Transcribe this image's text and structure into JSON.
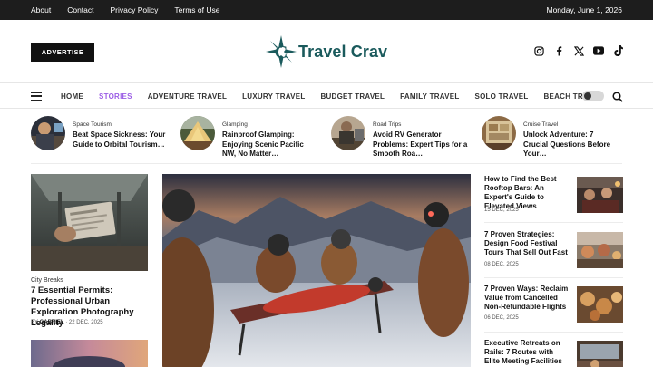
{
  "topbar": {
    "links": [
      "About",
      "Contact",
      "Privacy Policy",
      "Terms of Use"
    ],
    "date": "Monday, June 1, 2026"
  },
  "header": {
    "advertise_label": "ADVERTISE",
    "logo_text": "Travel Crav",
    "logo_color": "#1a5a5c",
    "social_icons": [
      "instagram-icon",
      "facebook-icon",
      "x-icon",
      "youtube-icon",
      "tiktok-icon"
    ]
  },
  "nav": {
    "items": [
      "HOME",
      "STORIES",
      "ADVENTURE TRAVEL",
      "LUXURY TRAVEL",
      "BUDGET TRAVEL",
      "FAMILY TRAVEL",
      "SOLO TRAVEL",
      "BEACH TRAVEL"
    ],
    "active_item": "STORIES",
    "active_color": "#9b5de5"
  },
  "trending": [
    {
      "category": "Space Tourism",
      "title": "Beat Space Sickness: Your Guide to Orbital Tourism…"
    },
    {
      "category": "Glamping",
      "title": "Rainproof Glamping: Enjoying Scenic Pacific NW, No Matter…"
    },
    {
      "category": "Road Trips",
      "title": "Avoid RV Generator Problems: Expert Tips for a Smooth Roa…"
    },
    {
      "category": "Cruise Travel",
      "title": "Unlock Adventure: 7 Crucial Questions Before Your…"
    }
  ],
  "left_feature": {
    "category": "City Breaks",
    "title": "7 Essential Permits: Professional Urban Exploration Photography Legality",
    "by_prefix": "BY",
    "author": "GABRIEL",
    "date": "22 DEC, 2025"
  },
  "right_list": [
    {
      "title": "How to Find the Best Rooftop Bars: An Expert's Guide to Elevated Views",
      "date": "15 DEC, 2025"
    },
    {
      "title": "7 Proven Strategies: Design Food Festival Tours That Sell Out Fast",
      "date": "08 DEC, 2025"
    },
    {
      "title": "7 Proven Ways: Reclaim Value from Cancelled Non-Refundable Flights",
      "date": "06 DEC, 2025"
    },
    {
      "title": "Executive Retreats on Rails: 7 Routes with Elite Meeting Facilities",
      "date": ""
    }
  ]
}
